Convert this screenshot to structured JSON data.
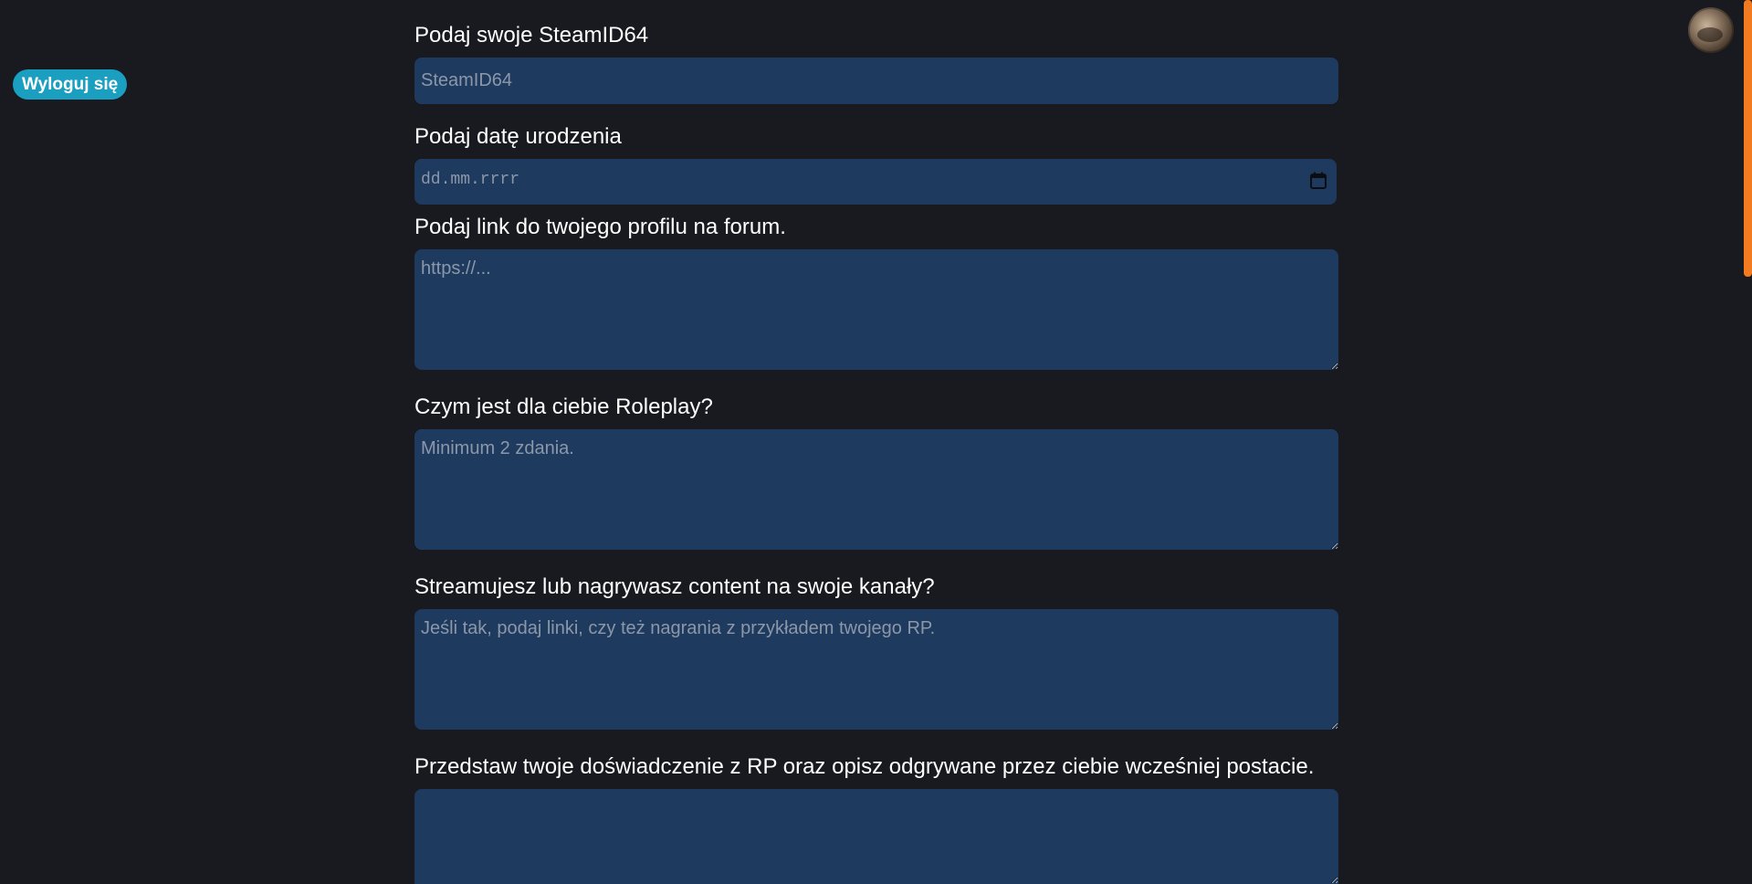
{
  "header": {
    "logout_label": "Wyloguj się",
    "avatar_icon": "user-avatar"
  },
  "form": {
    "steamid": {
      "label": "Podaj swoje SteamID64",
      "placeholder": "SteamID64"
    },
    "birthdate": {
      "label": "Podaj datę urodzenia",
      "placeholder": "dd.mm.rrrr",
      "icon": "calendar-icon"
    },
    "forum_link": {
      "label": "Podaj link do twojego profilu na forum.",
      "placeholder": "https://..."
    },
    "roleplay": {
      "label": "Czym jest dla ciebie Roleplay?",
      "placeholder": "Minimum 2 zdania."
    },
    "streaming": {
      "label": "Streamujesz lub nagrywasz content na swoje kanały?",
      "placeholder": "Jeśli tak, podaj linki, czy też nagrania z przykładem twojego RP."
    },
    "experience": {
      "label": "Przedstaw twoje doświadczenie z RP oraz opisz odgrywane przez ciebie wcześniej postacie.",
      "placeholder": ""
    }
  },
  "colors": {
    "background": "#191a1f",
    "field": "#1f3a5f",
    "accent": "#1a9fc0",
    "scrollbar": "#f27b1f"
  }
}
